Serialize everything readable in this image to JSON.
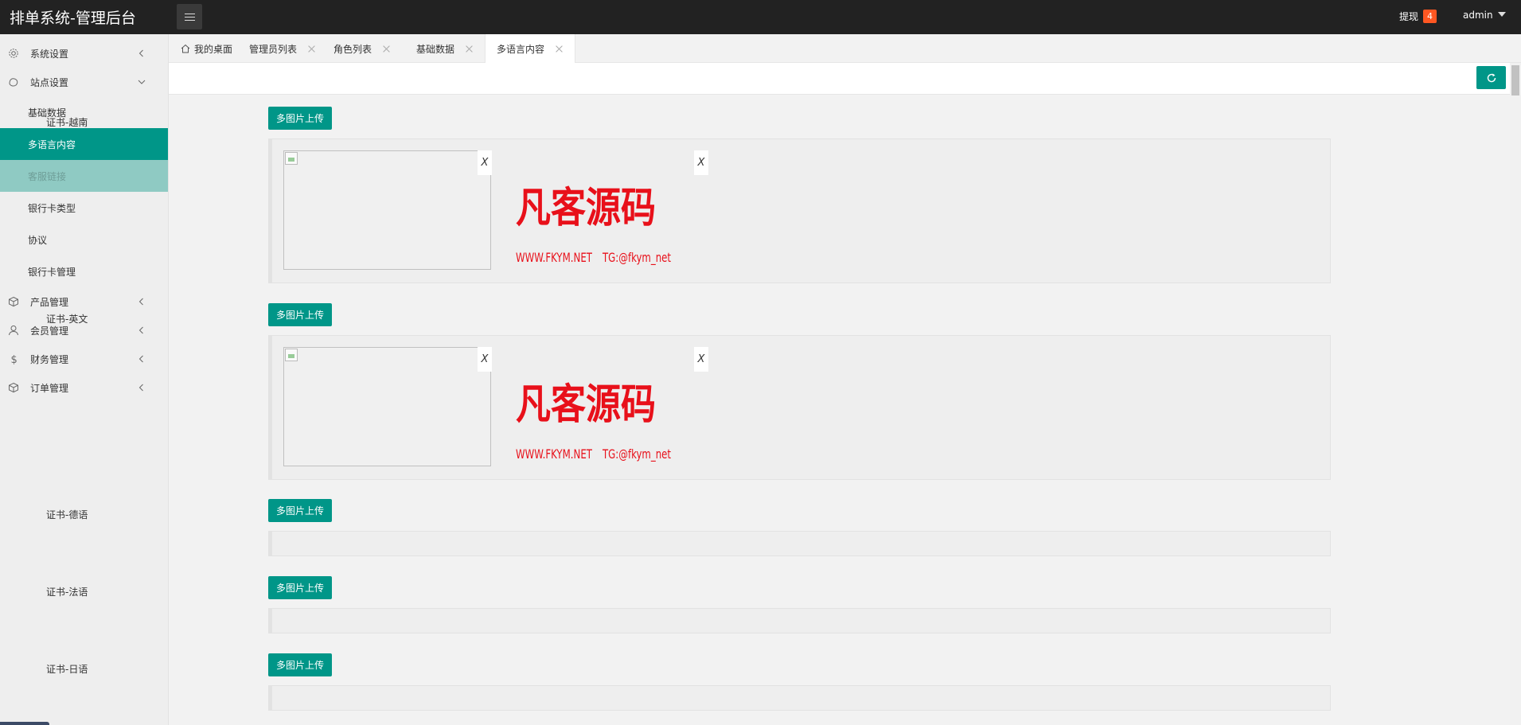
{
  "header": {
    "title": "排单系统-管理后台",
    "withdraw_label": "提现",
    "withdraw_count": "4",
    "user": "admin"
  },
  "sidebar": {
    "groups": [
      {
        "label": "系统设置",
        "icon": "gear-icon",
        "expanded": false
      },
      {
        "label": "站点设置",
        "icon": "site-icon",
        "expanded": true,
        "items": [
          {
            "label": "基础数据"
          },
          {
            "label": "多语言内容",
            "state": "active"
          },
          {
            "label": "客服链接",
            "state": "hover"
          },
          {
            "label": "银行卡类型"
          },
          {
            "label": "协议"
          },
          {
            "label": "银行卡管理"
          }
        ]
      },
      {
        "label": "产品管理",
        "icon": "box-icon",
        "expanded": false
      },
      {
        "label": "会员管理",
        "icon": "user-icon",
        "expanded": false
      },
      {
        "label": "财务管理",
        "icon": "dollar-icon",
        "expanded": false
      },
      {
        "label": "订单管理",
        "icon": "box-icon",
        "expanded": false
      }
    ]
  },
  "tabs": [
    {
      "label": "我的桌面",
      "icon": "home-icon",
      "closable": false
    },
    {
      "label": "管理员列表",
      "closable": true
    },
    {
      "label": "角色列表",
      "closable": true
    },
    {
      "label": "基础数据",
      "closable": true
    },
    {
      "label": "多语言内容",
      "closable": true,
      "active": true
    }
  ],
  "form": {
    "upload_label": "多图片上传",
    "delete_label": "X",
    "rows": [
      {
        "label": "证书-越南",
        "images": 2
      },
      {
        "label": "证书-英文",
        "images": 2
      },
      {
        "label": "证书-德语",
        "images": 0
      },
      {
        "label": "证书-法语",
        "images": 0
      },
      {
        "label": "证书-日语",
        "images": 0
      }
    ],
    "watermark": {
      "title": "凡客源码",
      "site": "WWW.FKYM.NET",
      "tg": "TG:@fkym_net",
      "color": "#e8101a"
    }
  },
  "colors": {
    "accent": "#009688",
    "header_bg": "#222222",
    "badge": "#ff5722"
  }
}
